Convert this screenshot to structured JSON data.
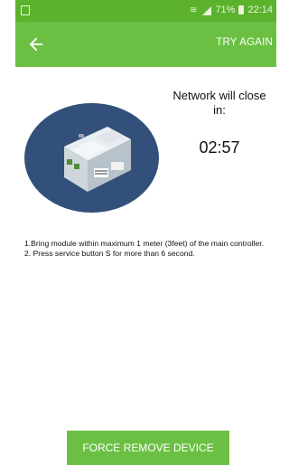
{
  "status_bar": {
    "battery": "71%",
    "time": "22:14"
  },
  "app_bar": {
    "back_icon": "arrow-left-icon",
    "try_again": "TRY AGAIN"
  },
  "main": {
    "network_text": "Network will close in:",
    "countdown": "02:57",
    "instructions": [
      "1.Bring module within maximum 1 meter (3feet) of the main controller.",
      "2. Press service button S for more than 6 second."
    ]
  },
  "footer": {
    "force_remove": "FORCE REMOVE DEVICE"
  },
  "colors": {
    "status_bar": "#5cb22d",
    "app_bar": "#6bc043",
    "circle": "#33507a",
    "button": "#6bc043"
  }
}
